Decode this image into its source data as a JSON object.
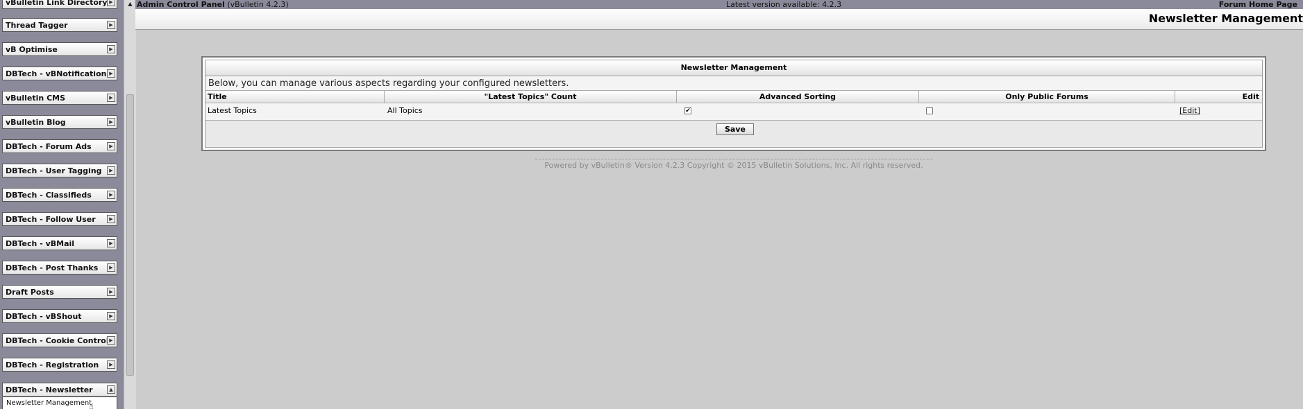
{
  "nav": {
    "groups": [
      {
        "label": "vBulletin Link Directory"
      },
      {
        "label": "Thread Tagger"
      },
      {
        "label": "vB Optimise"
      },
      {
        "label": "DBTech - vBNotifications"
      },
      {
        "label": "vBulletin CMS"
      },
      {
        "label": "vBulletin Blog"
      },
      {
        "label": "DBTech - Forum Ads"
      },
      {
        "label": "DBTech - User Tagging"
      },
      {
        "label": "DBTech - Classifieds"
      },
      {
        "label": "DBTech - Follow User"
      },
      {
        "label": "DBTech - vBMail"
      },
      {
        "label": "DBTech - Post Thanks"
      },
      {
        "label": "Draft Posts"
      },
      {
        "label": "DBTech - vBShout"
      },
      {
        "label": "DBTech - Cookie Control"
      },
      {
        "label": "DBTech - Registration"
      },
      {
        "label": "DBTech - Newsletter"
      }
    ],
    "expanded_submenu": {
      "label": "Newsletter Management"
    }
  },
  "topbar": {
    "title": "Admin Control Panel",
    "version": "(vBulletin 4.2.3)",
    "latest_version": "Latest version available: 4.2.3",
    "home_link": "Forum Home Page"
  },
  "page_title": "Newsletter Management",
  "panel": {
    "header": "Newsletter Management",
    "description": "Below, you can manage various aspects regarding your configured newsletters.",
    "columns": [
      "Title",
      "\"Latest Topics\" Count",
      "Advanced Sorting",
      "Only Public Forums",
      "Edit"
    ],
    "rows": [
      {
        "title": "Latest Topics",
        "count": "All Topics",
        "advanced_sorting": true,
        "only_public_forums": false,
        "edit": "[Edit]"
      }
    ],
    "save_label": "Save"
  },
  "copyright": "Powered by vBulletin® Version 4.2.3 Copyright © 2015 vBulletin Solutions, Inc. All rights reserved."
}
